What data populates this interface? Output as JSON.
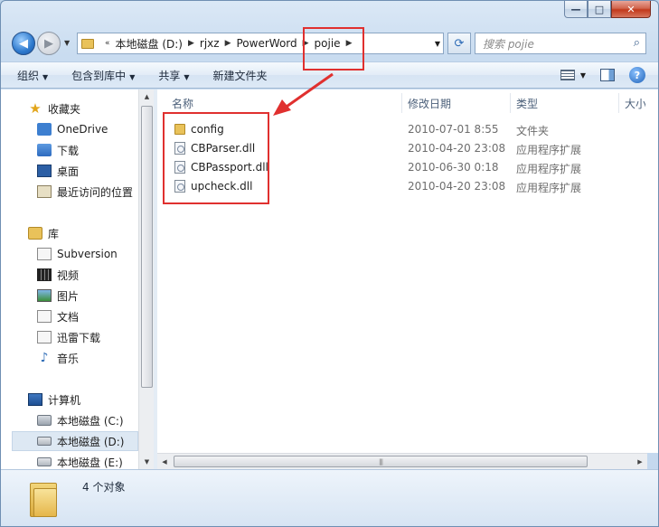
{
  "window": {
    "controls": {
      "min": "—",
      "max": "□",
      "close": "✕"
    }
  },
  "nav": {
    "breadcrumb": [
      "本地磁盘 (D:)",
      "rjxz",
      "PowerWord",
      "pojie"
    ],
    "search_placeholder": "搜索 pojie"
  },
  "toolbar": {
    "organize": "组织",
    "include_in_library": "包含到库中",
    "share": "共享",
    "new_folder": "新建文件夹"
  },
  "sidebar": {
    "favorites": {
      "header": "收藏夹",
      "items": [
        "OneDrive",
        "下载",
        "桌面",
        "最近访问的位置"
      ]
    },
    "libraries": {
      "header": "库",
      "items": [
        "Subversion",
        "视频",
        "图片",
        "文档",
        "迅雷下载",
        "音乐"
      ]
    },
    "computer": {
      "header": "计算机",
      "items": [
        "本地磁盘 (C:)",
        "本地磁盘 (D:)",
        "本地磁盘 (E:)"
      ],
      "selected": "本地磁盘 (D:)"
    }
  },
  "file_list": {
    "columns": [
      "名称",
      "修改日期",
      "类型",
      "大小"
    ],
    "rows": [
      {
        "name": "config",
        "date": "2010-07-01 8:55",
        "type": "文件夹",
        "icon": "folder-icon"
      },
      {
        "name": "CBParser.dll",
        "date": "2010-04-20 23:08",
        "type": "应用程序扩展",
        "icon": "dll-file-icon"
      },
      {
        "name": "CBPassport.dll",
        "date": "2010-06-30 0:18",
        "type": "应用程序扩展",
        "icon": "dll-file-icon"
      },
      {
        "name": "upcheck.dll",
        "date": "2010-04-20 23:08",
        "type": "应用程序扩展",
        "icon": "dll-file-icon"
      }
    ]
  },
  "status": {
    "count": "4 个对象"
  },
  "colors": {
    "highlight": "#e0302f",
    "selection": "#dde8f3"
  }
}
